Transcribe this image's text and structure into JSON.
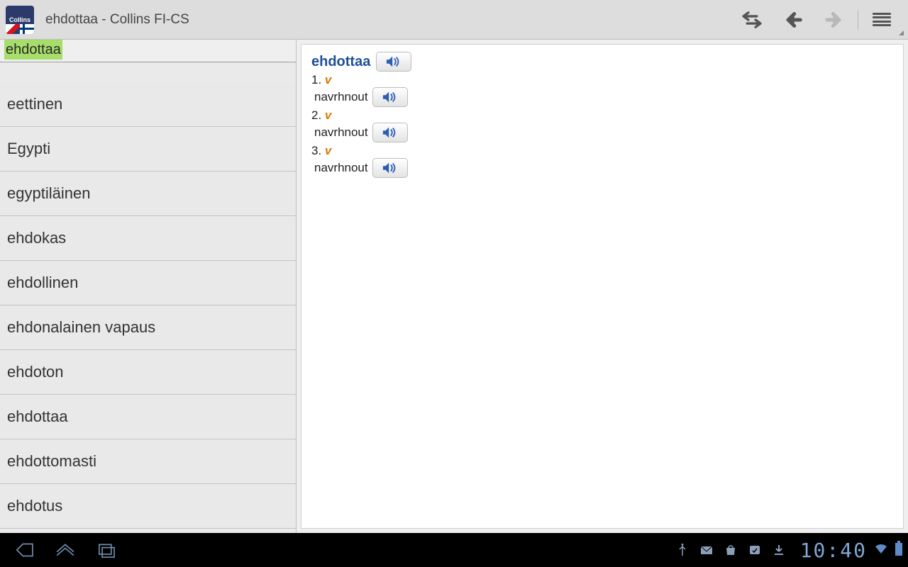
{
  "topbar": {
    "app_icon_label": "Collins",
    "title": "ehdottaa - Collins FI-CS"
  },
  "search": {
    "value": "ehdottaa"
  },
  "wordlist": [
    "eettinen",
    "Egypti",
    "egyptiläinen",
    "ehdokas",
    "ehdollinen",
    "ehdonalainen vapaus",
    "ehdoton",
    "ehdottaa",
    "ehdottomasti",
    "ehdotus"
  ],
  "entry": {
    "headword": "ehdottaa",
    "senses": [
      {
        "num": "1.",
        "pos": "v",
        "translation": "navrhnout"
      },
      {
        "num": "2.",
        "pos": "v",
        "translation": "navrhnout"
      },
      {
        "num": "3.",
        "pos": "v",
        "translation": "navrhnout"
      }
    ]
  },
  "status": {
    "time": "10:40"
  },
  "icons": {
    "swap": "swap-icon",
    "back": "back-icon",
    "fwd": "forward-icon",
    "menu": "menu-icon",
    "audio": "audio-icon"
  }
}
